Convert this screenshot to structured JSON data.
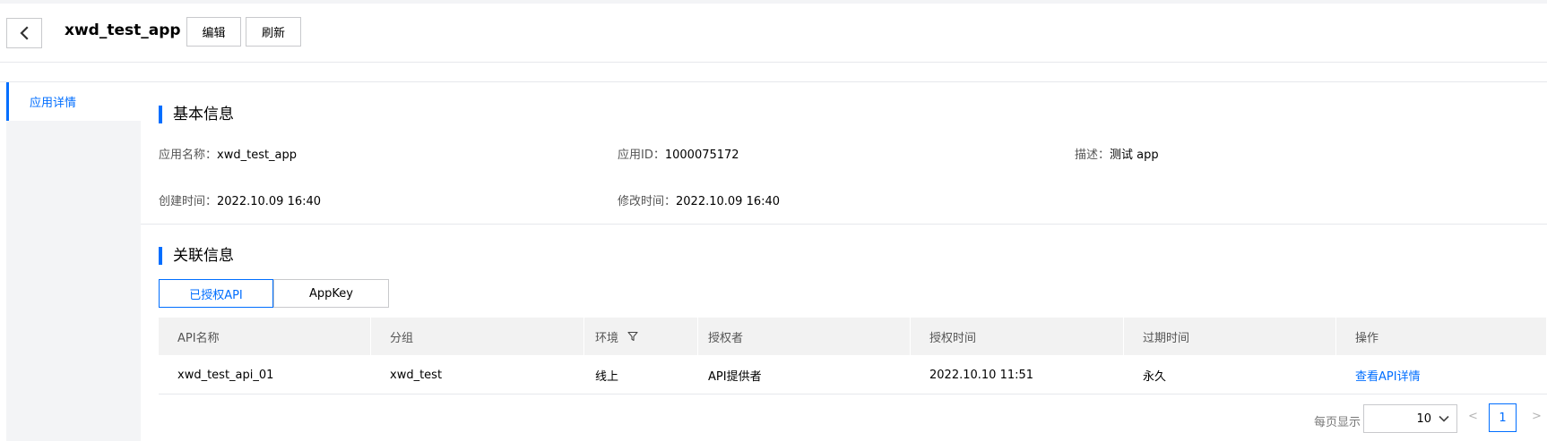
{
  "header": {
    "back_icon": "chevron-left-icon",
    "app_title": "xwd_test_app",
    "edit_label": "编辑",
    "refresh_label": "刷新"
  },
  "sidebar": {
    "items": [
      {
        "label": "应用详情",
        "active": true
      }
    ]
  },
  "basic_info": {
    "title": "基本信息",
    "app_name_label": "应用名称：",
    "app_name": "xwd_test_app",
    "app_id_label": "应用ID：",
    "app_id": "1000075172",
    "desc_label": "描述：",
    "desc": "测试 app",
    "created_label": "创建时间：",
    "created": "2022.10.09 16:40",
    "modified_label": "修改时间：",
    "modified": "2022.10.09 16:40"
  },
  "assoc_info": {
    "title": "关联信息",
    "tabs": [
      {
        "label": "已授权API",
        "active": true
      },
      {
        "label": "AppKey",
        "active": false
      }
    ]
  },
  "table": {
    "columns": [
      "API名称",
      "分组",
      "环境",
      "授权者",
      "授权时间",
      "过期时间",
      "操作"
    ],
    "filter_icon": "filter-icon",
    "rows": [
      {
        "api_name": "xwd_test_api_01",
        "group": "xwd_test",
        "env": "线上",
        "grantor": "API提供者",
        "auth_time": "2022.10.10 11:51",
        "expire": "永久",
        "action": "查看API详情"
      }
    ]
  },
  "pagination": {
    "per_page_label": "每页显示",
    "page_size": "10",
    "prev": "<",
    "current_page": "1",
    "next": ">"
  },
  "colors": {
    "accent": "#006eff",
    "border": "#c8c9cc",
    "header_bg": "#f2f2f2",
    "sidebar_bg": "#f3f4f6"
  }
}
